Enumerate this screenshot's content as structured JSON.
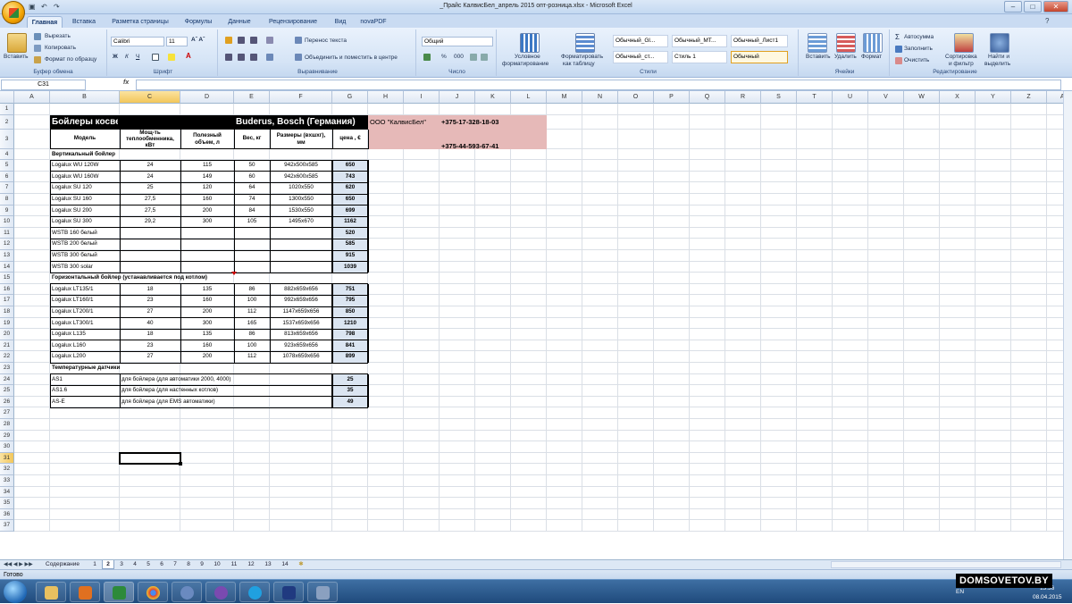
{
  "window": {
    "title": "_Прайс КалвисБел_апрель 2015 опт-розница.xlsx - Microsoft Excel"
  },
  "ribbon_tabs": [
    "Главная",
    "Вставка",
    "Разметка страницы",
    "Формулы",
    "Данные",
    "Рецензирование",
    "Вид",
    "novaPDF"
  ],
  "ribbon": {
    "paste": "Вставить",
    "cut": "Вырезать",
    "copy": "Копировать",
    "format_painter": "Формат по образцу",
    "clipboard": "Буфер обмена",
    "font_name": "Calibri",
    "font_size": "11",
    "font_group": "Шрифт",
    "wrap_text": "Перенос текста",
    "merge_center": "Объединить и поместить в центре",
    "alignment": "Выравнивание",
    "number_format": "Общий",
    "number": "Число",
    "cond_format_1": "Условное",
    "cond_format_2": "форматирование",
    "format_table_1": "Форматировать",
    "format_table_2": "как таблицу",
    "styles": [
      "Обычный_Gl...",
      "Обычный_МТ...",
      "Обычный_Лист1",
      "Обычный_ст...",
      "Стиль 1",
      "Обычный"
    ],
    "styles_group": "Стили",
    "insert": "Вставить",
    "delete": "Удалить",
    "format": "Формат",
    "cells_group": "Ячейки",
    "autosum": "Автосумма",
    "fill": "Заполнить",
    "clear": "Очистить",
    "sort_1": "Сортировка",
    "sort_2": "и фильтр",
    "find_1": "Найти и",
    "find_2": "выделить",
    "editing_group": "Редактирование"
  },
  "formula_bar": {
    "name_box": "C31",
    "fx": "fx",
    "formula": ""
  },
  "columns": [
    "A",
    "B",
    "C",
    "D",
    "E",
    "F",
    "G",
    "H",
    "I",
    "J",
    "K",
    "L",
    "M",
    "N",
    "O",
    "P",
    "Q",
    "R",
    "S",
    "T",
    "U",
    "V",
    "W",
    "X",
    "Y",
    "Z",
    "AA"
  ],
  "rows": [
    "1",
    "2",
    "3",
    "4",
    "5",
    "6",
    "7",
    "8",
    "9",
    "10",
    "11",
    "12",
    "13",
    "14",
    "15",
    "16",
    "17",
    "18",
    "19",
    "20",
    "21",
    "22",
    "23",
    "24",
    "25",
    "26",
    "27",
    "28",
    "29",
    "30",
    "31",
    "32",
    "33",
    "34",
    "35",
    "36",
    "37"
  ],
  "sheet": {
    "title": "Бойлеры косвенного нагрева",
    "brand": "Buderus, Bosch (Германия)",
    "company": "ООО \"КалвисБел\"",
    "phone1": "+375-17-328-18-03",
    "phone2": "+375-44-593-67-41",
    "headers": {
      "model": "Модель",
      "power": [
        "Мощ-ть",
        "теплообменника,",
        "кВт"
      ],
      "volume": [
        "Полезный",
        "объем, л"
      ],
      "weight": "Вес, кг",
      "dims": [
        "Размеры (вхшхг),",
        "мм"
      ],
      "price": "цена , €"
    },
    "section_vertical": "Вертикальный бойлер",
    "section_horizontal": "Горизонтальный бойлер (устанавливается под котлом)",
    "section_sensors": "Температурные датчики",
    "vertical": [
      [
        "Logalux WU 120W",
        "24",
        "115",
        "50",
        "942x500x585",
        "650"
      ],
      [
        "Logalux WU 160W",
        "24",
        "149",
        "60",
        "942x600x585",
        "743"
      ],
      [
        "Logalux SU 120",
        "25",
        "120",
        "64",
        "1020x550",
        "620"
      ],
      [
        "Logalux SU 160",
        "27,5",
        "160",
        "74",
        "1300x550",
        "650"
      ],
      [
        "Logalux SU 200",
        "27,5",
        "200",
        "84",
        "1530x550",
        "699"
      ],
      [
        "Logalux SU 300",
        "29,2",
        "300",
        "105",
        "1495x670",
        "1162"
      ],
      [
        "WSTB 160 белый",
        "",
        "",
        "",
        "",
        "520"
      ],
      [
        "WSTB 200 белый",
        "",
        "",
        "",
        "",
        "585"
      ],
      [
        "WSTB 300 белый",
        "",
        "",
        "",
        "",
        "915"
      ],
      [
        "WSTB 300 solar",
        "",
        "",
        "",
        "",
        "1039"
      ]
    ],
    "horizontal": [
      [
        "Logalux LT135/1",
        "18",
        "135",
        "86",
        "882x659x656",
        "751"
      ],
      [
        "Logalux LT160/1",
        "23",
        "160",
        "100",
        "992x659x656",
        "795"
      ],
      [
        "Logalux LT200/1",
        "27",
        "200",
        "112",
        "1147x659x656",
        "850"
      ],
      [
        "Logalux LT300/1",
        "40",
        "300",
        "165",
        "1537x659x656",
        "1210"
      ],
      [
        "Logalux L135",
        "18",
        "135",
        "86",
        "813x659x656",
        "798"
      ],
      [
        "Logalux L160",
        "23",
        "160",
        "100",
        "923x659x656",
        "841"
      ],
      [
        "Logalux L200",
        "27",
        "200",
        "112",
        "1078x659x656",
        "899"
      ]
    ],
    "sensors": [
      [
        "AS1",
        "для бойлера (для автоматики 2000, 4000)",
        "25"
      ],
      [
        "AS1.6",
        "для бойлера (для настенных котлов)",
        "35"
      ],
      [
        "AS-E",
        "для бойлера (для EMS автоматики)",
        "49"
      ]
    ]
  },
  "sheet_tabs": [
    "Содержание",
    "1",
    "2",
    "3",
    "4",
    "5",
    "6",
    "7",
    "8",
    "9",
    "10",
    "11",
    "12",
    "13",
    "14"
  ],
  "status": {
    "ready": "Готово"
  },
  "tray": {
    "lang": "EN",
    "time": "13:36",
    "date": "08.04.2015"
  },
  "watermark": "DOMSOVETOV.BY"
}
